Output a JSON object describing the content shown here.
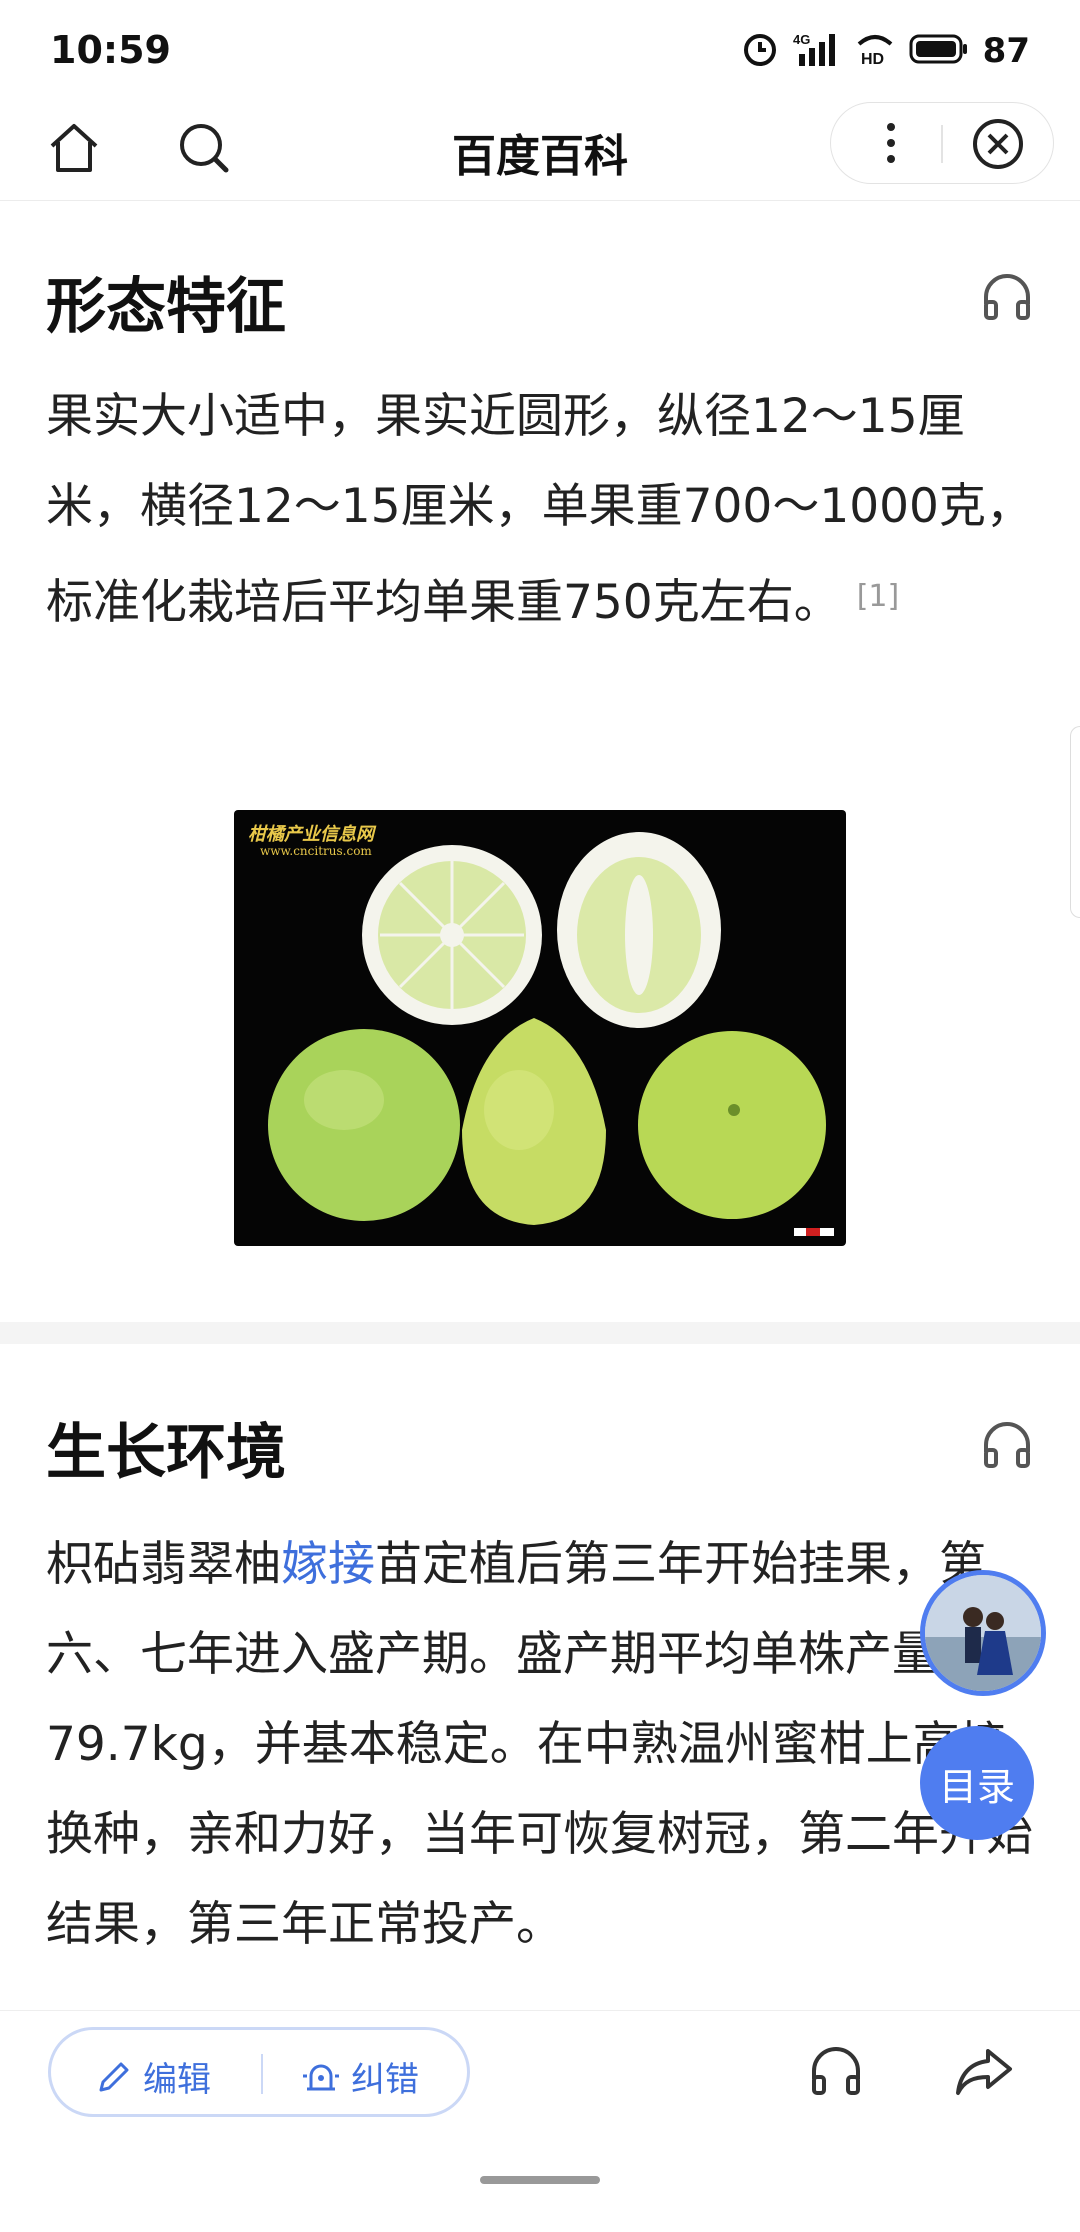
{
  "status_bar": {
    "time": "10:59",
    "network": "4G",
    "hd": "HD",
    "battery": "87"
  },
  "nav": {
    "title": "百度百科"
  },
  "sections": [
    {
      "title": "形态特征",
      "paragraph": "果实大小适中，果实近圆形，纵径12～15厘米，横径12～15厘米，单果重700～1000克，标准化栽培后平均单果重750克左右。",
      "reference": "[1]"
    },
    {
      "title": "生长环境",
      "paragraph_before_link": "枳砧翡翠柚",
      "link": "嫁接",
      "paragraph_after_link": "苗定植后第三年开始挂果，第六、七年进入盛产期。盛产期平均单株产量可达79.7kg，并基本稳定。在中熟温州蜜柑上高接换种，亲和力好，当年可恢复树冠，第二年开始结果，第三年正常投产。"
    }
  ],
  "image": {
    "caption": "柑橘产业信息网",
    "caption_url": "www.cncitrus.com"
  },
  "floating": {
    "toc_label": "目录"
  },
  "bottom_bar": {
    "edit_label": "编辑",
    "correct_label": "纠错"
  },
  "colors": {
    "accent": "#4f7df0",
    "link": "#3e6fdc"
  }
}
